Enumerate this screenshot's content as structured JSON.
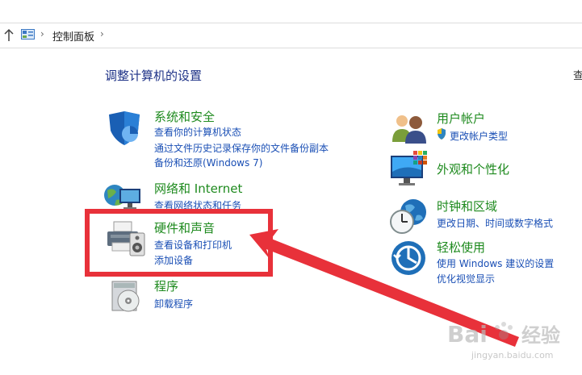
{
  "breadcrumb": {
    "current": "控制面板"
  },
  "page": {
    "title": "调整计算机的设置",
    "view_by_cut": "查"
  },
  "left": [
    {
      "id": "security",
      "title": "系统和安全",
      "links": [
        "查看你的计算机状态",
        "通过文件历史记录保存你的文件备份副本",
        "备份和还原(Windows 7)"
      ]
    },
    {
      "id": "network",
      "title": "网络和 Internet",
      "links": [
        "查看网络状态和任务"
      ]
    },
    {
      "id": "hardware",
      "title": "硬件和声音",
      "links": [
        "查看设备和打印机",
        "添加设备"
      ]
    },
    {
      "id": "programs",
      "title": "程序",
      "links": [
        "卸载程序"
      ]
    }
  ],
  "right": [
    {
      "id": "user",
      "title": "用户帐户",
      "links": [
        "更改帐户类型"
      ]
    },
    {
      "id": "appearance",
      "title": "外观和个性化",
      "links": []
    },
    {
      "id": "clock",
      "title": "时钟和区域",
      "links": [
        "更改日期、时间或数字格式"
      ]
    },
    {
      "id": "ease",
      "title": "轻松使用",
      "links": [
        "使用 Windows 建议的设置",
        "优化视觉显示"
      ]
    }
  ],
  "watermark": {
    "brand": "Bai",
    "brand_cn": "经验",
    "url": "jingyan.baidu.com"
  },
  "colors": {
    "category_title": "#1e8a1e",
    "link": "#1a4fb5",
    "page_title": "#1e3287",
    "highlight": "#e8313a"
  }
}
